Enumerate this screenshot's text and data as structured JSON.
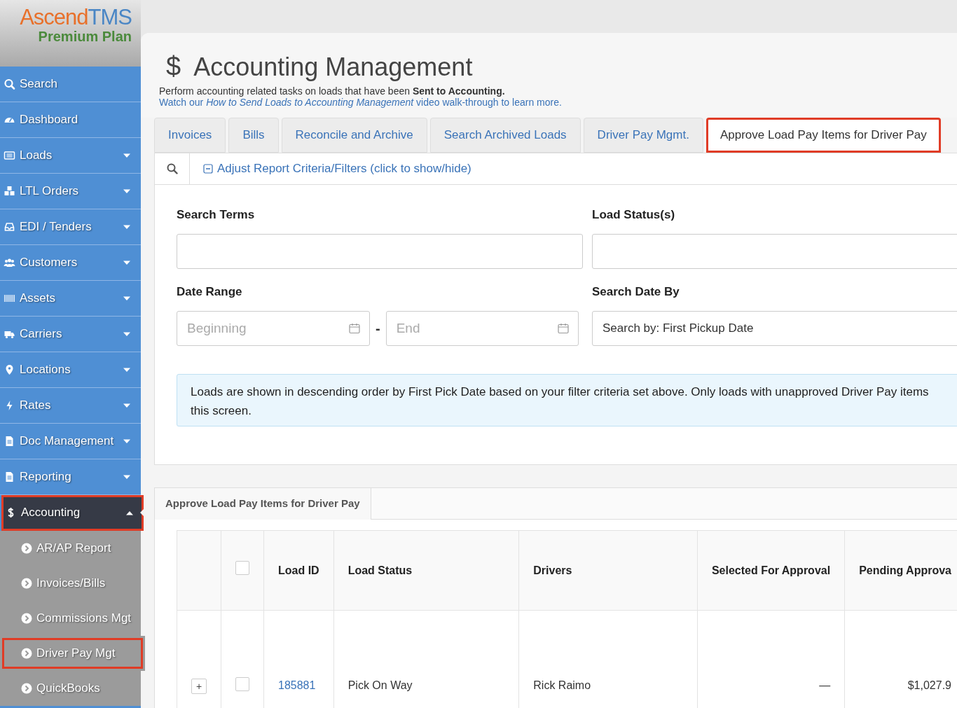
{
  "logo": {
    "brand_a": "Ascend",
    "brand_b": "TMS",
    "plan": "Premium Plan"
  },
  "sidebar": {
    "items": [
      {
        "label": "Search",
        "selected": false,
        "highlighted": false
      },
      {
        "label": "Dashboard",
        "selected": false,
        "highlighted": false
      },
      {
        "label": "Loads",
        "expanded": false,
        "selected": false,
        "highlighted": false
      },
      {
        "label": "LTL Orders",
        "expanded": false,
        "selected": false,
        "highlighted": false
      },
      {
        "label": "EDI / Tenders",
        "expanded": false,
        "selected": false,
        "highlighted": false
      },
      {
        "label": "Customers",
        "expanded": false,
        "selected": false,
        "highlighted": false
      },
      {
        "label": "Assets",
        "expanded": false,
        "selected": false,
        "highlighted": false
      },
      {
        "label": "Carriers",
        "expanded": false,
        "selected": false,
        "highlighted": false
      },
      {
        "label": "Locations",
        "expanded": false,
        "selected": false,
        "highlighted": false
      },
      {
        "label": "Rates",
        "expanded": false,
        "selected": false,
        "highlighted": false
      },
      {
        "label": "Doc Management",
        "expanded": false,
        "selected": false,
        "highlighted": false
      },
      {
        "label": "Reporting",
        "expanded": false,
        "selected": false,
        "highlighted": false
      },
      {
        "label": "Accounting",
        "expanded": true,
        "selected": true,
        "highlighted": true,
        "children": [
          {
            "label": "AR/AP Report",
            "highlighted": false
          },
          {
            "label": "Invoices/Bills",
            "highlighted": false
          },
          {
            "label": "Commissions Mgt",
            "highlighted": false
          },
          {
            "label": "Driver Pay Mgt",
            "highlighted": true
          },
          {
            "label": "QuickBooks",
            "highlighted": false
          }
        ]
      }
    ]
  },
  "header": {
    "icon": "$",
    "title": "Accounting Management",
    "subtitle": "Perform accounting related tasks on loads that have been **Sent to Accounting.**",
    "help": "Watch our *How to Send Loads to Accounting Management* video walk-through to learn more."
  },
  "tabs": [
    {
      "label": "Invoices",
      "selected": false,
      "highlighted": false
    },
    {
      "label": "Bills",
      "selected": false,
      "highlighted": false
    },
    {
      "label": "Reconcile and Archive",
      "selected": false,
      "highlighted": false
    },
    {
      "label": "Search Archived Loads",
      "selected": false,
      "highlighted": false
    },
    {
      "label": "Driver Pay Mgmt.",
      "selected": false,
      "highlighted": false
    },
    {
      "label": "Approve Load Pay Items for Driver Pay",
      "selected": true,
      "highlighted": true
    }
  ],
  "filters": {
    "toggle": "Adjust Report Criteria/Filters (click to show/hide)",
    "expanded": true,
    "search_terms": {
      "label": "Search Terms"
    },
    "load_statuses": {
      "label": "Load Status(s)"
    },
    "date_range": {
      "label": "Date Range",
      "begin": {
        "placeholder": "Beginning"
      },
      "separator": "-",
      "end": {
        "placeholder": "End"
      }
    },
    "search_date_by": {
      "label": "Search Date By",
      "value": "Search by: First Pickup Date"
    },
    "info_lines": [
      "Loads are shown in descending order by First Pick Date based on your filter criteria set above. Only loads with unapproved Driver Pay items",
      "this screen."
    ]
  },
  "results": {
    "tab": "Approve Load Pay Items for Driver Pay",
    "table": {
      "select_all": false,
      "columns": [
        "Load ID",
        "Load Status",
        "Drivers",
        "Selected For Approval",
        "Pending Approva"
      ],
      "rows": [
        {
          "expand": "+",
          "checked": false,
          "load_id": "185881",
          "load_status": "Pick On Way",
          "drivers": "Rick Raimo",
          "selected_for_approval": "—",
          "pending_approval": "$1,027.9"
        }
      ]
    }
  }
}
